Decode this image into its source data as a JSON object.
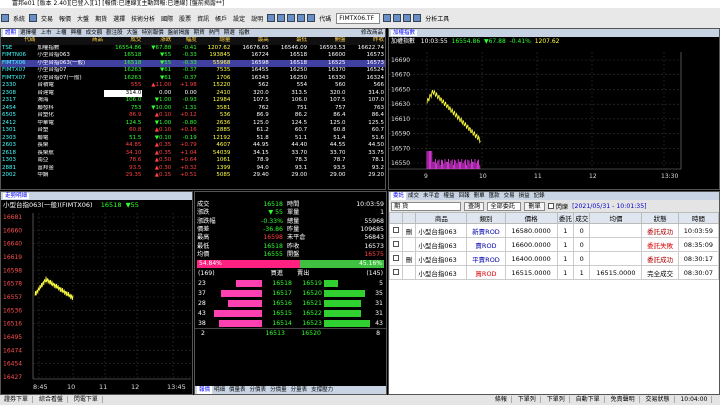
{
  "window": {
    "title": "富邦e01 [版本 2.40][已登入][1] [報價:已連線][主動回報:已連線]  [盤前揭露**]"
  },
  "menu": {
    "items": [
      "系統",
      "交易",
      "報價",
      "大盤",
      "期貨",
      "選擇",
      "技術分析",
      "國際",
      "股票",
      "資訊",
      "帳戶",
      "設定",
      "說明"
    ],
    "code_label": "代碼",
    "code_value": "FIMTX06.TF",
    "analysis_label": "分析工具"
  },
  "quote": {
    "tabs": [
      "證期",
      "選擇權",
      "上市",
      "上櫃",
      "興櫃",
      "成交額",
      "觀注股",
      "大盤",
      "特別報價",
      "盤前揭露",
      "期貨",
      "熱門",
      "期選",
      "指數"
    ],
    "right_label": "修改商品",
    "headers": [
      "代碼",
      "商品",
      "成交",
      "漲跌",
      "幅度",
      "總量",
      "最高",
      "最低",
      "開盤",
      "昨收"
    ],
    "rows": [
      {
        "code": "TSE",
        "name": "加權指數",
        "price": "16554.86",
        "chg": "▼67.88",
        "pct": "-0.41",
        "vol": "1207.62",
        "hi": "16676.65",
        "lo": "16546.09",
        "open": "16593.53",
        "prev": "16622.74",
        "dir": "dn"
      },
      {
        "code": "FIMTN06",
        "name": "小型台指063",
        "price": "16518",
        "chg": "▼55",
        "pct": "-0.33",
        "vol": "193845",
        "hi": "16724",
        "lo": "16518",
        "open": "16600",
        "prev": "16573",
        "dir": "dn"
      },
      {
        "code": "FIMTX06",
        "name": "小型台指063(一般)",
        "price": "16518",
        "chg": "▼55",
        "pct": "-0.33",
        "vol": "55968",
        "hi": "16598",
        "lo": "16518",
        "open": "16525",
        "prev": "16573",
        "dir": "dn"
      },
      {
        "code": "FIMTX07",
        "name": "小型台指07",
        "price": "16263",
        "chg": "▼61",
        "pct": "-0.37",
        "vol": "7535",
        "hi": "16455",
        "lo": "16250",
        "open": "16370",
        "prev": "16524",
        "dir": "dn"
      },
      {
        "code": "FIMTX07",
        "name": "小型台指07(一般)",
        "price": "16263",
        "chg": "▼61",
        "pct": "-0.37",
        "vol": "1706",
        "hi": "16343",
        "lo": "16250",
        "open": "16330",
        "prev": "16324",
        "dir": "dn"
      },
      {
        "code": "2330",
        "name": "台積電",
        "price": "555",
        "chg": "▲11.00",
        "pct": "+1.98",
        "vol": "15220",
        "hi": "562",
        "lo": "554",
        "open": "560",
        "prev": "566",
        "dir": "up"
      },
      {
        "code": "2308",
        "name": "台達電",
        "price": "314.0",
        "chg": "0.00",
        "pct": "0.00",
        "vol": "2410",
        "hi": "320.0",
        "lo": "313.5",
        "open": "320.0",
        "prev": "314.0",
        "dir": "wh"
      },
      {
        "code": "2317",
        "name": "鴻海",
        "price": "106.0",
        "chg": "▼1.00",
        "pct": "-0.93",
        "vol": "12984",
        "hi": "107.5",
        "lo": "106.0",
        "open": "107.5",
        "prev": "107.0",
        "dir": "dn"
      },
      {
        "code": "2454",
        "name": "聯發科",
        "price": "753",
        "chg": "▼10.00",
        "pct": "-1.31",
        "vol": "3581",
        "hi": "762",
        "lo": "751",
        "open": "757",
        "prev": "763",
        "dir": "dn"
      },
      {
        "code": "6505",
        "name": "台塑化",
        "price": "86.9",
        "chg": "▲0.10",
        "pct": "+0.12",
        "vol": "536",
        "hi": "86.9",
        "lo": "86.2",
        "open": "86.4",
        "prev": "86.4",
        "dir": "up"
      },
      {
        "code": "2412",
        "name": "中華電",
        "price": "124.5",
        "chg": "▼1.00",
        "pct": "-0.80",
        "vol": "2636",
        "hi": "125.0",
        "lo": "124.5",
        "open": "125.0",
        "prev": "125.5",
        "dir": "dn"
      },
      {
        "code": "1301",
        "name": "台塑",
        "price": "60.8",
        "chg": "▲0.10",
        "pct": "+0.16",
        "vol": "2885",
        "hi": "61.2",
        "lo": "60.7",
        "open": "60.8",
        "prev": "60.7",
        "dir": "up"
      },
      {
        "code": "2303",
        "name": "聯電",
        "price": "51.5",
        "chg": "▼0.10",
        "pct": "-0.19",
        "vol": "12192",
        "hi": "51.8",
        "lo": "51.1",
        "open": "51.4",
        "prev": "51.6",
        "dir": "dn"
      },
      {
        "code": "2603",
        "name": "長榮",
        "price": "44.85",
        "chg": "▲0.35",
        "pct": "+0.79",
        "vol": "4607",
        "hi": "44.95",
        "lo": "44.40",
        "open": "44.55",
        "prev": "44.50",
        "dir": "up"
      },
      {
        "code": "2618",
        "name": "長榮航",
        "price": "34.10",
        "chg": "▲0.35",
        "pct": "+1.04",
        "vol": "54039",
        "hi": "34.15",
        "lo": "33.70",
        "open": "33.70",
        "prev": "33.75",
        "dir": "up"
      },
      {
        "code": "1303",
        "name": "南亞",
        "price": "78.6",
        "chg": "▲0.50",
        "pct": "+0.64",
        "vol": "1061",
        "hi": "78.9",
        "lo": "78.3",
        "open": "78.7",
        "prev": "78.1",
        "dir": "up"
      },
      {
        "code": "2881",
        "name": "富邦金",
        "price": "93.5",
        "chg": "▲0.30",
        "pct": "+0.32",
        "vol": "1399",
        "hi": "94.0",
        "lo": "93.1",
        "open": "93.5",
        "prev": "93.2",
        "dir": "up"
      },
      {
        "code": "2002",
        "name": "中鋼",
        "price": "29.35",
        "chg": "▲0.15",
        "pct": "+0.51",
        "vol": "5085",
        "hi": "29.40",
        "lo": "29.00",
        "open": "29.00",
        "prev": "29.20",
        "dir": "up"
      }
    ]
  },
  "mini_chart": {
    "title": "加權指數",
    "time": "10:03:55",
    "price": "16554.86",
    "chg": "▼67.88",
    "pct": "-0.41%",
    "vol": "1207.62",
    "y_ticks": [
      "16690",
      "16670",
      "16650",
      "16630",
      "16610",
      "16590",
      "16570",
      "16550"
    ],
    "x_ticks": [
      "9",
      "10",
      "11",
      "12",
      "13:30"
    ]
  },
  "tick_chart": {
    "tab": "走勢明細",
    "symbol": "小型台指063(一般)(FIMTX06)",
    "price": "16518",
    "chg": "▼55",
    "y_ticks": [
      "16681",
      "16660",
      "16640",
      "16619",
      "16598",
      "16578",
      "16557",
      "16536",
      "16516",
      "16495",
      "16474",
      "16454",
      "16427"
    ],
    "x_ticks": [
      "8:45",
      "10",
      "11",
      "12",
      "13:45"
    ]
  },
  "detail": {
    "rows": [
      [
        "成交",
        "16518",
        "時間",
        "10:03:59"
      ],
      [
        "漲跌",
        "▼ 55",
        "單量",
        "1"
      ],
      [
        "漲跌幅",
        "-0.33%",
        "總量",
        "55968"
      ],
      [
        "價差",
        "-36.86",
        "昨量",
        "109685"
      ],
      [
        "最高",
        "16598",
        "未平倉",
        "56843"
      ],
      [
        "最低",
        "16518",
        "昨收",
        "16573"
      ],
      [
        "均價",
        "16555",
        "開盤",
        "16575"
      ]
    ],
    "buy_pct": "54.84%",
    "sell_pct": "45.16%",
    "buy_total": "(169)",
    "sell_total": "(145)",
    "ob_head": [
      "買進",
      "賣出"
    ],
    "book": [
      {
        "bq": "23",
        "bp": "16518",
        "sp": "16519",
        "sq": "5",
        "bw": 0.55,
        "sw": 0.3
      },
      {
        "bq": "37",
        "bp": "16517",
        "sp": "16520",
        "sq": "35",
        "bw": 0.85,
        "sw": 0.9
      },
      {
        "bq": "28",
        "bp": "16516",
        "sp": "16521",
        "sq": "31",
        "bw": 0.7,
        "sw": 0.8
      },
      {
        "bq": "43",
        "bp": "16515",
        "sp": "16522",
        "sq": "31",
        "bw": 1.0,
        "sw": 0.8
      },
      {
        "bq": "38",
        "bp": "16514",
        "sp": "16523",
        "sq": "43",
        "bw": 0.9,
        "sw": 1.0
      }
    ],
    "summary": [
      "2",
      "16513",
      "16520",
      "8"
    ],
    "bottom_tabs": [
      "報價",
      "明細",
      "價量表",
      "分價表",
      "分價量",
      "分量表",
      "支撐壓力"
    ]
  },
  "orders": {
    "tabs": [
      "委託",
      "成交",
      "未平倉",
      "權益",
      "回報",
      "刪單",
      "匯款",
      "交易",
      "損益",
      "記錄"
    ],
    "account_value": "期 貨",
    "query_label": "查詢",
    "filter_value": "全部委託",
    "delete_label": "刪單",
    "flash_label": "閃爍",
    "time_range": "[2021/05/31 - 10:01:35]",
    "headers": [
      "",
      "",
      "商品",
      "類別",
      "價格",
      "委託",
      "成交",
      "均價",
      "狀態",
      "時間"
    ],
    "rows": [
      {
        "item": "小型台指063",
        "type": "新賣ROD",
        "price": "16580.0000",
        "ord": "1",
        "fill": "0",
        "avg": "",
        "status": "委託成功",
        "time": "10:03:59",
        "cls": "dn"
      },
      {
        "item": "小型台指063",
        "type": "賣ROD",
        "price": "16600.0000",
        "ord": "1",
        "fill": "0",
        "avg": "",
        "status": "委託失敗",
        "time": "08:35:09",
        "cls": "dn"
      },
      {
        "item": "小型台指063",
        "type": "平賣ROD",
        "price": "16400.0000",
        "ord": "1",
        "fill": "0",
        "avg": "",
        "status": "委託成功",
        "time": "08:30:17",
        "cls": "dn"
      },
      {
        "item": "小型台指063",
        "type": "買ROD",
        "price": "16515.0000",
        "ord": "1",
        "fill": "1",
        "avg": "16515.0000",
        "status": "完全成交",
        "time": "08:30:07",
        "cls": "up"
      }
    ],
    "cancel_label": "刪"
  },
  "status": {
    "items": [
      "證券下單",
      "綜合看盤",
      "閃電下單",
      "條報",
      "下單列",
      "下單列",
      "自動下單",
      "免責聲明",
      "交易狀態",
      "10:04:00"
    ]
  }
}
